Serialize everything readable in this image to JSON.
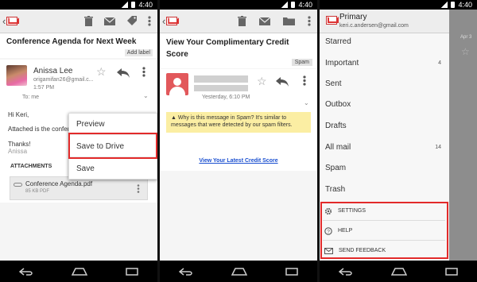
{
  "status_time": "4:40",
  "screen1": {
    "subject": "Conference Agenda for Next Week",
    "add_label": "Add label",
    "sender_name": "Anissa Lee",
    "sender_email": "origamifan26@gmail.c...",
    "time": "1:57 PM",
    "to": "To: me",
    "greeting": "Hi Keri,",
    "body_line": "Attached is the confer",
    "thanks": "Thanks!",
    "signature": "Anissa",
    "attachments_header": "ATTACHMENTS",
    "attachment_name": "Conference Agenda.pdf",
    "attachment_meta": "85 KB PDF",
    "menu": [
      "Preview",
      "Save to Drive",
      "Save"
    ]
  },
  "screen2": {
    "subject": "View Your Complimentary Credit Score",
    "spam_tag": "Spam",
    "time": "Yesterday, 6:10 PM",
    "warning": "Why is this message in Spam? It's similar to messages that were detected by our spam filters.",
    "link": "View Your Latest Credit Score"
  },
  "screen3": {
    "title": "Primary",
    "email": "keri.c.andersen@gmail.com",
    "behind_date": "Apr 3",
    "folders": [
      {
        "label": "Starred",
        "count": ""
      },
      {
        "label": "Important",
        "count": "4"
      },
      {
        "label": "Sent",
        "count": ""
      },
      {
        "label": "Outbox",
        "count": ""
      },
      {
        "label": "Drafts",
        "count": ""
      },
      {
        "label": "All mail",
        "count": "14"
      },
      {
        "label": "Spam",
        "count": ""
      },
      {
        "label": "Trash",
        "count": ""
      }
    ],
    "footer": [
      "SETTINGS",
      "HELP",
      "SEND FEEDBACK"
    ]
  },
  "colors": {
    "highlight": "#e22a2a",
    "spam_warning_bg": "#fbeea3",
    "link": "#1a4fd0"
  }
}
